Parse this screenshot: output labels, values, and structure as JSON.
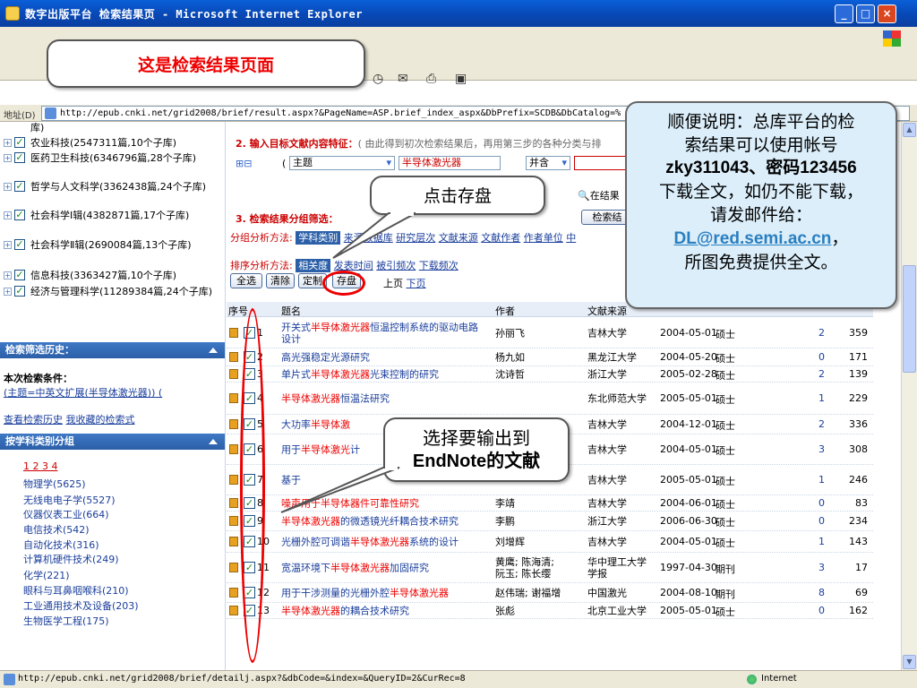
{
  "window": {
    "title": "数字出版平台 检索结果页 - Microsoft Internet Explorer",
    "controls": [
      "_",
      "□",
      "×"
    ]
  },
  "address": {
    "label": "地址(D)",
    "url": "http://epub.cnki.net/grid2008/brief/result.aspx?&PageName=ASP.brief_index_aspx&DbPrefix=SCDB&DbCatalog=%"
  },
  "sidebar": {
    "tree": [
      {
        "label": "库)",
        "checked": true
      },
      {
        "label": "农业科技(2547311篇,10个子库)",
        "checked": true
      },
      {
        "label": "医药卫生科技(6346796篇,28个子库)",
        "checked": true
      },
      {
        "label": "哲学与人文科学(3362438篇,24个子库)",
        "checked": true
      },
      {
        "label": "社会科学Ⅰ辑(4382871篇,17个子库)",
        "checked": true
      },
      {
        "label": "社会科学Ⅱ辑(2690084篇,13个子库)",
        "checked": true
      },
      {
        "label": "信息科技(3363427篇,10个子库)",
        "checked": true
      },
      {
        "label": "经济与管理科学(11289384篇,24个子库)",
        "checked": true
      }
    ],
    "history_header": "检索筛选历史：",
    "condition_label": "本次检索条件：",
    "condition_value": "(主题=中英文扩展(半导体激光器)) (",
    "history_links": [
      "查看检索历史",
      "我收藏的检索式"
    ],
    "group_header": "按学科类别分组",
    "pages": "1 2 3 4",
    "categories": [
      "物理学(5625)",
      "无线电电子学(5527)",
      "仪器仪表工业(664)",
      "电信技术(542)",
      "自动化技术(316)",
      "计算机硬件技术(249)",
      "化学(221)",
      "眼科与耳鼻咽喉科(210)",
      "工业通用技术及设备(203)",
      "生物医学工程(175)"
    ]
  },
  "main": {
    "step2_title": "2. 输入目标文献内容特征：",
    "step2_hint": "( 由此得到初次检索结果后，再用第三步的各种分类与排",
    "field_select": "主题",
    "field_value": "半导体激光器",
    "and_select": "并含",
    "search_in_results": "在结果",
    "step3_title": "3. 检索结果分组筛选：",
    "step3_button": "检索结",
    "group_analysis_label": "分组分析方法:",
    "group_tabs": [
      "学科类别",
      "来源数据库",
      "研究层次",
      "文献来源",
      "文献作者",
      "作者单位",
      "中"
    ],
    "sort_label": "排序分析方法:",
    "sort_options": [
      "相关度",
      "发表时间",
      "被引频次",
      "下载频次"
    ],
    "buttons": [
      "全选",
      "清除",
      "定制",
      "存盘"
    ],
    "pager": [
      "上页",
      "下页"
    ],
    "table_headers": {
      "seq": "序号",
      "title": "题名",
      "author": "作者",
      "source": "文献来源"
    },
    "rows": [
      {
        "num": "1",
        "title_pre": "开关式",
        "title_hl": "半导体激光器",
        "title_post": "恒温控制系统的驱动电路设计",
        "author": "孙丽飞",
        "source": "吉林大学",
        "date": "2004-05-01",
        "type": "硕士",
        "cited": "2",
        "downloads": "359"
      },
      {
        "num": "2",
        "title_pre": "高光强稳定光源研究",
        "title_hl": "",
        "title_post": "",
        "author": "杨九如",
        "source": "黑龙江大学",
        "date": "2004-05-20",
        "type": "硕士",
        "cited": "0",
        "downloads": "171"
      },
      {
        "num": "3",
        "title_pre": "单片式",
        "title_hl": "半导体激光器",
        "title_post": "光束控制的研究",
        "author": "沈诗哲",
        "source": "浙江大学",
        "date": "2005-02-28",
        "type": "硕士",
        "cited": "2",
        "downloads": "139"
      },
      {
        "num": "4",
        "title_pre": "",
        "title_hl": "半导体激光器",
        "title_post": "恒温法研究",
        "author": "",
        "source": "东北师范大学",
        "date": "2005-05-01",
        "type": "硕士",
        "cited": "1",
        "downloads": "229"
      },
      {
        "num": "5",
        "title_pre": "大功率",
        "title_hl": "半导体激",
        "title_post": "",
        "author": "",
        "source": "吉林大学",
        "date": "2004-12-01",
        "type": "硕士",
        "cited": "2",
        "downloads": "336"
      },
      {
        "num": "6",
        "title_pre": "用于",
        "title_hl": "半导体激光",
        "title_post": "计",
        "author": "",
        "source": "吉林大学",
        "date": "2004-05-01",
        "type": "硕士",
        "cited": "3",
        "downloads": "308"
      },
      {
        "num": "7",
        "title_pre": "基于",
        "title_hl": "",
        "title_post": "",
        "author": "",
        "source": "吉林大学",
        "date": "2005-05-01",
        "type": "硕士",
        "cited": "1",
        "downloads": "246"
      },
      {
        "num": "8",
        "title_pre": "",
        "title_hl": "噪声用于半导体器件可靠性研究",
        "title_post": "",
        "author": "李靖",
        "source": "吉林大学",
        "date": "2004-06-01",
        "type": "硕士",
        "cited": "0",
        "downloads": "83"
      },
      {
        "num": "9",
        "title_pre": "",
        "title_hl": "半导体激光器",
        "title_post": "的微透镜光纤耦合技术研究",
        "author": "李鹏",
        "source": "浙江大学",
        "date": "2006-06-30",
        "type": "硕士",
        "cited": "0",
        "downloads": "234"
      },
      {
        "num": "10",
        "title_pre": "光栅外腔可调谐",
        "title_hl": "半导体激光器",
        "title_post": "系统的设计",
        "author": "刘增辉",
        "source": "吉林大学",
        "date": "2004-05-01",
        "type": "硕士",
        "cited": "1",
        "downloads": "143"
      },
      {
        "num": "11",
        "title_pre": "宽温环境下",
        "title_hl": "半导体激光器",
        "title_post": "加固研究",
        "author": "黄鹰; 陈海清; 阮玉; 陈长缨",
        "source": "华中理工大学学报",
        "date": "1997-04-30",
        "type": "期刊",
        "cited": "3",
        "downloads": "17"
      },
      {
        "num": "12",
        "title_pre": "用于干涉测量的光栅外腔",
        "title_hl": "半导体激光器",
        "title_post": "",
        "author": "赵伟瑞; 谢福增",
        "source": "中国激光",
        "date": "2004-08-10",
        "type": "期刊",
        "cited": "8",
        "downloads": "69"
      },
      {
        "num": "13",
        "title_pre": "",
        "title_hl": "半导体激光器",
        "title_post": "的耦合技术研究",
        "author": "张彪",
        "source": "北京工业大学",
        "date": "2005-05-01",
        "type": "硕士",
        "cited": "0",
        "downloads": "162"
      }
    ]
  },
  "callouts": {
    "page_label": "这是检索结果页面",
    "save_hint": "点击存盘",
    "select_hint_line1": "选择要输出到",
    "select_hint_line2": "EndNote的文献",
    "note_line1": "顺便说明：总库平台的检",
    "note_line2": "索结果可以使用帐号",
    "note_line3": "zky311043、密码123456",
    "note_line4": "下载全文，如仍不能下载，",
    "note_line5": "请发邮件给：",
    "note_email": "DL@red.semi.ac.cn",
    "note_email_suffix": "，",
    "note_line6": "所图免费提供全文。"
  },
  "status": {
    "text": "http://epub.cnki.net/grid2008/brief/detailj.aspx?&dbCode=&index=&QueryID=2&CurRec=8",
    "zone": "Internet"
  }
}
